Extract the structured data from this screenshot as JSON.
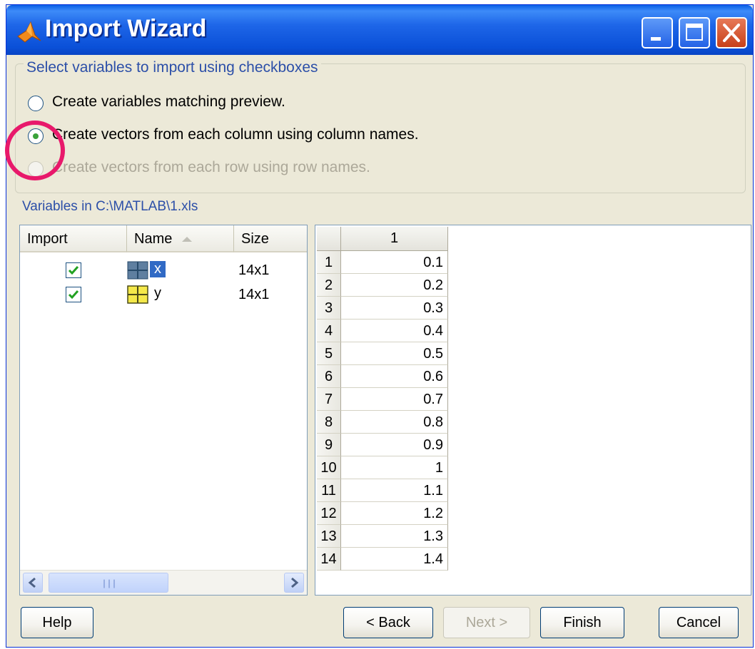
{
  "window": {
    "title": "Import Wizard",
    "controls": {
      "minimize": "minimize-icon",
      "maximize": "maximize-icon",
      "close": "close-icon"
    }
  },
  "options": {
    "legend": "Select variables to import using checkboxes",
    "radios": [
      {
        "label": "Create variables matching preview.",
        "selected": false,
        "enabled": true
      },
      {
        "label": "Create vectors from each column using column names.",
        "selected": true,
        "enabled": true
      },
      {
        "label": "Create vectors from each row using row names.",
        "selected": false,
        "enabled": false
      }
    ]
  },
  "variables": {
    "label": "Variables in C:\\MATLAB\\1.xls",
    "columns": {
      "import": "Import",
      "name": "Name",
      "size": "Size"
    },
    "rows": [
      {
        "checked": true,
        "name": "x",
        "size": "14x1",
        "selected": true
      },
      {
        "checked": true,
        "name": "y",
        "size": "14x1",
        "selected": false
      }
    ]
  },
  "preview": {
    "column_header": "1",
    "row_labels": [
      "1",
      "2",
      "3",
      "4",
      "5",
      "6",
      "7",
      "8",
      "9",
      "10",
      "11",
      "12",
      "13",
      "14"
    ],
    "values": [
      "0.1",
      "0.2",
      "0.3",
      "0.4",
      "0.5",
      "0.6",
      "0.7",
      "0.8",
      "0.9",
      "1",
      "1.1",
      "1.2",
      "1.3",
      "1.4"
    ]
  },
  "buttons": {
    "help": "Help",
    "back": "< Back",
    "next": "Next >",
    "finish": "Finish",
    "cancel": "Cancel"
  },
  "colors": {
    "title_bar": "#0a50d8",
    "annotation_circle": "#e8196b",
    "selection": "#316ac5"
  }
}
